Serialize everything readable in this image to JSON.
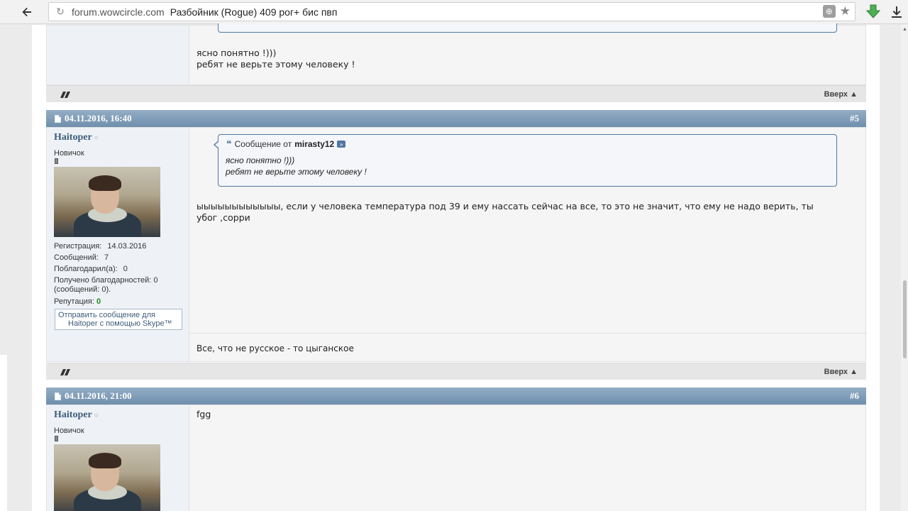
{
  "browser": {
    "url_host": "forum.wowcircle.com",
    "page_title": "Разбойник (Rogue) 409 рог+ бис пвп"
  },
  "prev_post": {
    "message_line1": "ясно понятно !)))",
    "message_line2": "ребят не верьте этому человеку !",
    "top_link": "Вверх ▲"
  },
  "post5": {
    "date": "04.11.2016, 16:40",
    "number": "#5",
    "username": "Haitoper",
    "user_title": "Новичок",
    "stats": {
      "reg_label": "Регистрация:",
      "reg_value": "14.03.2016",
      "msgs_label": "Сообщений:",
      "msgs_value": "7",
      "thanked_label": "Поблагодарил(а):",
      "thanked_value": "0",
      "received_line1": "Получено благодарностей: 0",
      "received_line2": "(сообщений: 0).",
      "rep_label": "Репутация:",
      "rep_value": "0"
    },
    "skype_text_line1": "Отправить сообщение для",
    "skype_text_line2": "Haitoper с помощью Skype™",
    "quote_prefix": "Сообщение от",
    "quote_author": "mirasty12",
    "quote_line1": "ясно понятно !)))",
    "quote_line2": "ребят не верьте этому человеку !",
    "message_line1": "ыыыыыыыыыыыы, если у человека температура под 39 и ему нассать сейчас на все, то это не значит, что ему не надо верить, ты",
    "message_line2": "убог ,сорри",
    "signature": "Все, что не русское - то цыганское",
    "top_link": "Вверх ▲"
  },
  "post6": {
    "date": "04.11.2016, 21:00",
    "number": "#6",
    "username": "Haitoper",
    "user_title": "Новичок",
    "message": "fgg"
  }
}
